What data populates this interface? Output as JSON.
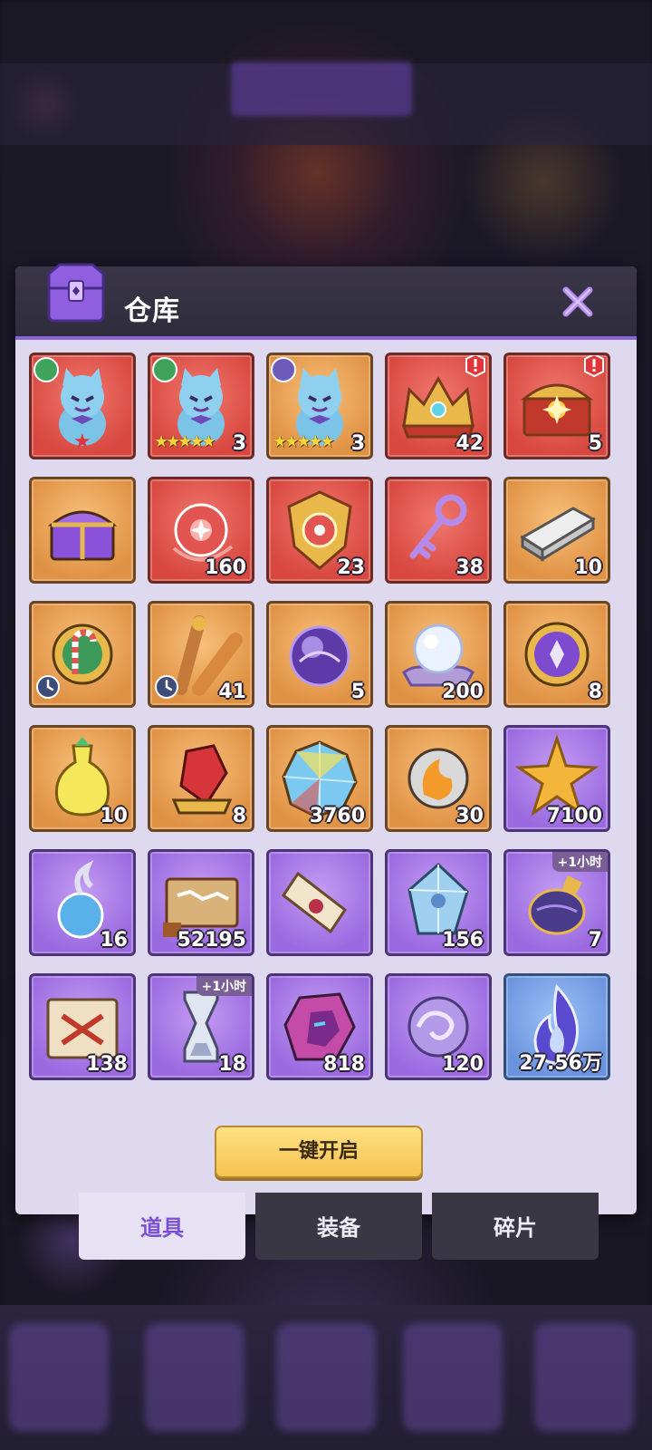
{
  "panel": {
    "title": "仓库",
    "open_all_label": "一键开启"
  },
  "items": [
    {
      "bg": "red",
      "art": "cat",
      "element": "green",
      "star_marker": "★"
    },
    {
      "bg": "red",
      "art": "cat",
      "element": "green",
      "stars": "★★★★★",
      "count": "3"
    },
    {
      "bg": "orange",
      "art": "cat",
      "element": "violet",
      "stars": "★★★★★",
      "count": "3"
    },
    {
      "bg": "red",
      "art": "crown",
      "count": "42",
      "alert": true
    },
    {
      "bg": "red",
      "art": "chest",
      "count": "5",
      "alert": true
    },
    {
      "bg": "orange",
      "art": "purple-chest"
    },
    {
      "bg": "red",
      "art": "red-orb",
      "count": "160"
    },
    {
      "bg": "red",
      "art": "shield",
      "count": "23"
    },
    {
      "bg": "red",
      "art": "key",
      "count": "38"
    },
    {
      "bg": "orange",
      "art": "bar",
      "count": "10"
    },
    {
      "bg": "orange",
      "art": "candy-medal",
      "timed": true
    },
    {
      "bg": "orange",
      "art": "scrolls",
      "count": "41",
      "timed": true
    },
    {
      "bg": "orange",
      "art": "purple-sphere",
      "count": "5"
    },
    {
      "bg": "orange",
      "art": "pearl",
      "count": "200"
    },
    {
      "bg": "orange",
      "art": "purple-medal",
      "count": "8"
    },
    {
      "bg": "orange",
      "art": "potion",
      "count": "10"
    },
    {
      "bg": "orange",
      "art": "red-gem",
      "count": "8"
    },
    {
      "bg": "orange",
      "art": "prism",
      "count": "3760"
    },
    {
      "bg": "orange",
      "art": "fire-orb",
      "count": "30"
    },
    {
      "bg": "purple",
      "art": "gold-star",
      "count": "7100"
    },
    {
      "bg": "purple",
      "art": "soul",
      "count": "16"
    },
    {
      "bg": "purple",
      "art": "map",
      "count": "52195"
    },
    {
      "bg": "purple",
      "art": "scroll",
      "count": ""
    },
    {
      "bg": "purple",
      "art": "crystal",
      "count": "156"
    },
    {
      "bg": "purple",
      "art": "bottle",
      "count": "7",
      "time_tag": "+1小时"
    },
    {
      "bg": "purple",
      "art": "red-scroll",
      "count": "138"
    },
    {
      "bg": "purple",
      "art": "hourglass",
      "count": "18",
      "time_tag": "+1小时"
    },
    {
      "bg": "purple",
      "art": "pink-gem",
      "count": "818"
    },
    {
      "bg": "purple",
      "art": "swirl-orb",
      "count": "120"
    },
    {
      "bg": "blue",
      "art": "flame",
      "count": "27.56万"
    }
  ],
  "tabs": [
    {
      "label": "道具",
      "active": true
    },
    {
      "label": "装备",
      "active": false
    },
    {
      "label": "碎片",
      "active": false
    }
  ],
  "colors": {
    "accent": "#8a66d9",
    "tab_active_text": "#7a4fd5",
    "button_gold": "#f6c350"
  }
}
